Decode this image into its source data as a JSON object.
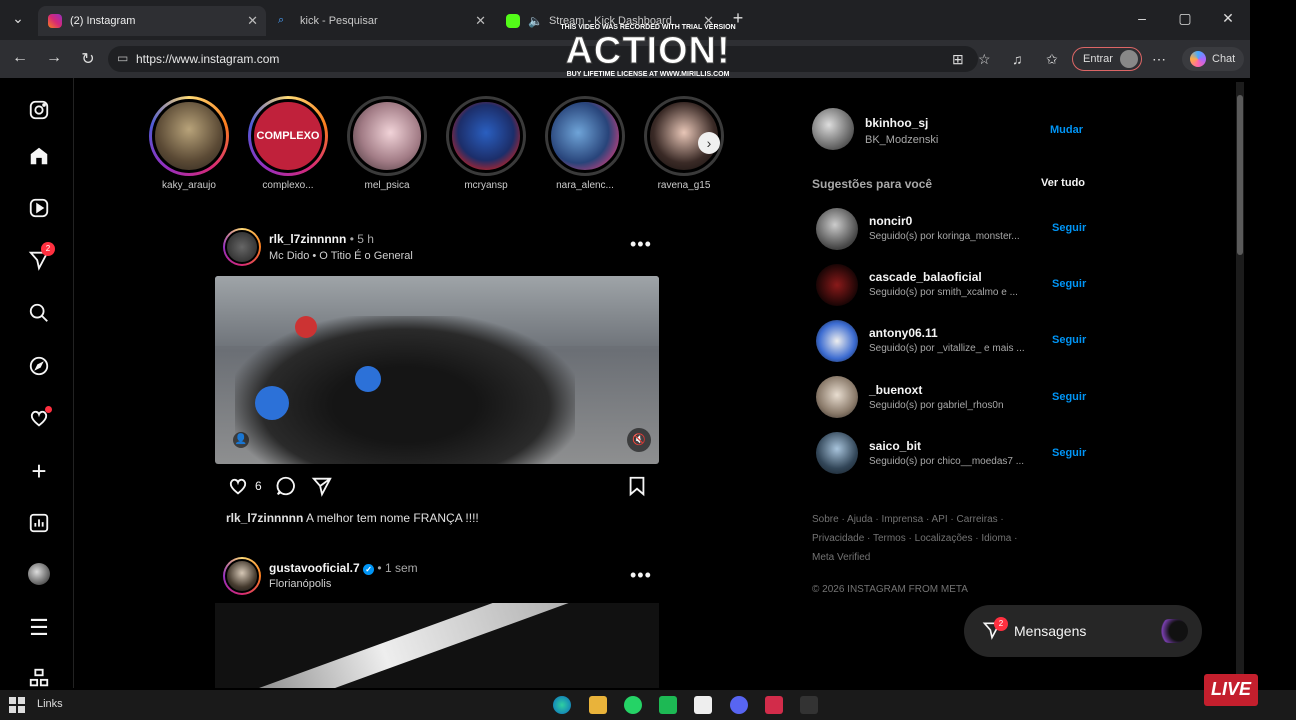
{
  "browser": {
    "tabs": [
      {
        "title": "(2) Instagram",
        "active": true
      },
      {
        "title": "kick - Pesquisar",
        "active": false
      },
      {
        "title": "Stream - Kick Dashboard",
        "active": false
      }
    ],
    "url": "https://www.instagram.com",
    "entrar_label": "Entrar",
    "chat_label": "Chat"
  },
  "watermark": {
    "top": "THIS VIDEO WAS RECORDED WITH TRIAL VERSION",
    "big": "ACTION!",
    "bottom": "BUY LIFETIME LICENSE AT WWW.MIRILLIS.COM"
  },
  "sidebar": {
    "notifications_badge": "2"
  },
  "stories": [
    {
      "username": "kaky_araujo",
      "seen": false
    },
    {
      "username": "complexo...",
      "seen": false,
      "avatar_text": "COMPLEXO"
    },
    {
      "username": "mel_psica",
      "seen": true
    },
    {
      "username": "mcryansp",
      "seen": true
    },
    {
      "username": "nara_alenc...",
      "seen": true
    },
    {
      "username": "ravena_g15",
      "seen": true
    }
  ],
  "posts": [
    {
      "username": "rlk_l7zinnnnn",
      "time": "5 h",
      "subtitle": "Mc Dido • O Titio É o General",
      "likes": "6",
      "caption_user": "rlk_l7zinnnnn",
      "caption_text": "A melhor tem nome FRANÇA !!!!"
    },
    {
      "username": "gustavooficial.7",
      "time": "1 sem",
      "subtitle": "Florianópolis"
    }
  ],
  "right": {
    "me": {
      "username": "bkinhoo_sj",
      "name": "BK_Modzenski",
      "switch_label": "Mudar"
    },
    "suggestions_title": "Sugestões para você",
    "see_all": "Ver tudo",
    "follow_label": "Seguir",
    "suggestions": [
      {
        "username": "noncir0",
        "sub": "Seguido(s) por koringa_monster..."
      },
      {
        "username": "cascade_balaoficial",
        "sub": "Seguido(s) por smith_xcalmo e ..."
      },
      {
        "username": "antony06.11",
        "sub": "Seguido(s) por _vitallize_ e mais ..."
      },
      {
        "username": "_buenoxt",
        "sub": "Seguido(s) por gabriel_rhos0n"
      },
      {
        "username": "saico_bit",
        "sub": "Seguido(s) por chico__moedas7 ..."
      }
    ],
    "footer_line1": "Sobre · Ajuda · Imprensa · API · Carreiras ·",
    "footer_line2": "Privacidade · Termos · Localizações · Idioma ·",
    "footer_line3": "Meta Verified",
    "copyright": "© 2026 INSTAGRAM FROM META"
  },
  "messages": {
    "label": "Mensagens",
    "badge": "2"
  },
  "taskbar": {
    "links_label": "Links",
    "live_label": "LIVE"
  }
}
